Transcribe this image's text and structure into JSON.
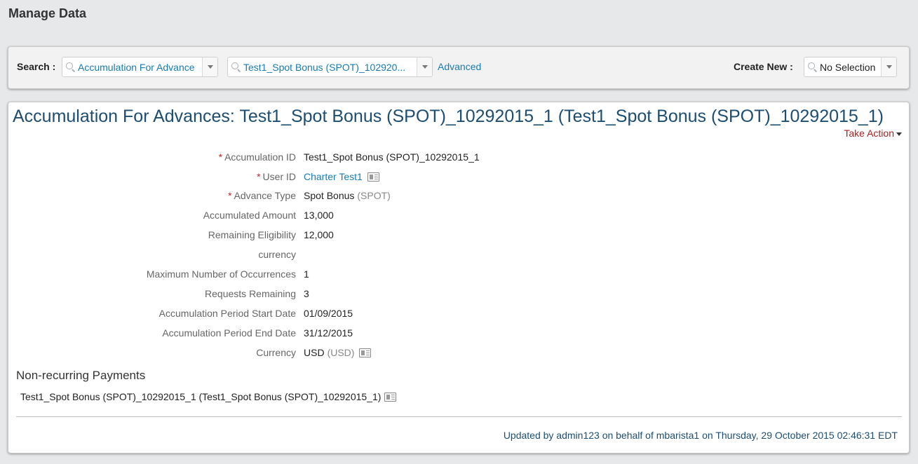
{
  "page": {
    "title": "Manage Data"
  },
  "search": {
    "label": "Search :",
    "type_value": "Accumulation For Advance",
    "record_value": "Test1_Spot Bonus (SPOT)_102920...",
    "advanced_label": "Advanced"
  },
  "create_new": {
    "label": "Create New :",
    "value": "No Selection"
  },
  "record": {
    "title": "Accumulation For Advances: Test1_Spot Bonus (SPOT)_10292015_1 (Test1_Spot Bonus (SPOT)_10292015_1)",
    "take_action_label": "Take Action",
    "fields": {
      "accumulation_id": {
        "label": "Accumulation ID",
        "value": "Test1_Spot Bonus (SPOT)_10292015_1"
      },
      "user_id": {
        "label": "User ID",
        "value": "Charter Test1"
      },
      "advance_type": {
        "label": "Advance Type",
        "value": "Spot Bonus",
        "code": "(SPOT)"
      },
      "accumulated_amount": {
        "label": "Accumulated Amount",
        "value": "13,000"
      },
      "remaining_eligibility": {
        "label": "Remaining Eligibility",
        "value": "12,000"
      },
      "currency_blank": {
        "label": "currency",
        "value": ""
      },
      "max_occurrences": {
        "label": "Maximum Number of Occurrences",
        "value": "1"
      },
      "requests_remaining": {
        "label": "Requests Remaining",
        "value": "3"
      },
      "period_start": {
        "label": "Accumulation Period Start Date",
        "value": "01/09/2015"
      },
      "period_end": {
        "label": "Accumulation Period End Date",
        "value": "31/12/2015"
      },
      "currency": {
        "label": "Currency",
        "value": "USD",
        "code": "(USD)"
      }
    },
    "required_marker": "*"
  },
  "non_recurring": {
    "heading": "Non-recurring Payments",
    "item": "Test1_Spot Bonus (SPOT)_10292015_1 (Test1_Spot Bonus (SPOT)_10292015_1)"
  },
  "footer": {
    "updated_text": "Updated by admin123 on behalf of mbarista1 on Thursday, 29 October 2015 02:46:31 EDT"
  },
  "icons": {
    "search": "magnifier-icon",
    "dropdown": "chevron-down-icon",
    "card": "id-card-icon"
  }
}
